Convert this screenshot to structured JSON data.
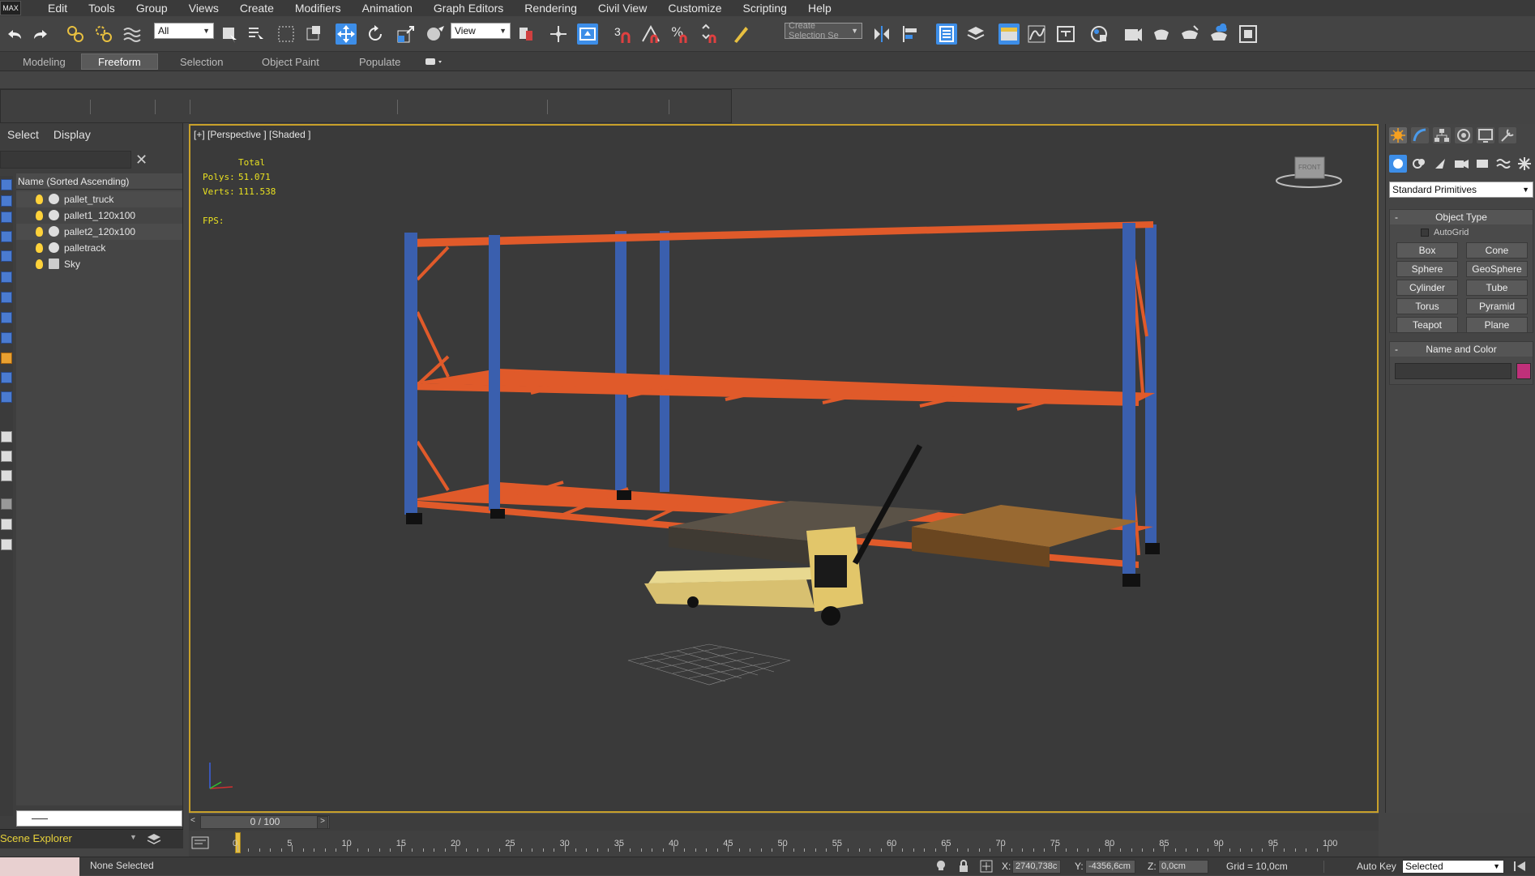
{
  "menu": {
    "logo": "MAX",
    "items": [
      "Edit",
      "Tools",
      "Group",
      "Views",
      "Create",
      "Modifiers",
      "Animation",
      "Graph Editors",
      "Rendering",
      "Civil View",
      "Customize",
      "Scripting",
      "Help"
    ]
  },
  "toolbar": {
    "filter_value": "All",
    "ref_coord_value": "View",
    "selection_set_placeholder": "Create Selection Se",
    "snap_label": "3"
  },
  "ribbon": {
    "tabs": [
      "Modeling",
      "Freeform",
      "Selection",
      "Object Paint",
      "Populate"
    ],
    "active_tab": "Freeform"
  },
  "explorer": {
    "tabs": [
      "Select",
      "Display"
    ],
    "column_header": "Name (Sorted Ascending)",
    "objects": [
      "pallet_truck",
      "pallet1_120x100",
      "pallet2_120x100",
      "palletrack",
      "Sky"
    ],
    "footer_label": "Scene Explorer"
  },
  "viewport": {
    "label": "[+] [Perspective ] [Shaded ]",
    "stats": {
      "total_label": "Total",
      "polys_label": "Polys:",
      "polys_value": "51.071",
      "verts_label": "Verts:",
      "verts_value": "111.538",
      "fps_label": "FPS:"
    },
    "viewcube_label": "FRONT"
  },
  "command_panel": {
    "category": "Standard Primitives",
    "object_type_title": "Object Type",
    "autogrid_label": "AutoGrid",
    "primitives": [
      "Box",
      "Cone",
      "Sphere",
      "GeoSphere",
      "Cylinder",
      "Tube",
      "Torus",
      "Pyramid",
      "Teapot",
      "Plane"
    ],
    "name_color_title": "Name and Color",
    "object_color": "#c0307a"
  },
  "timeline": {
    "frame_display": "0 / 100",
    "ticks": [
      "0",
      "5",
      "10",
      "15",
      "20",
      "25",
      "30",
      "35",
      "40",
      "45",
      "50",
      "55",
      "60",
      "65",
      "70",
      "75",
      "80",
      "85",
      "90",
      "95",
      "100"
    ]
  },
  "status": {
    "selection_text": "None Selected",
    "x_label": "X:",
    "x_value": "2740,738c",
    "y_label": "Y:",
    "y_value": "-4356,6cm",
    "z_label": "Z:",
    "z_value": "0,0cm",
    "grid_text": "Grid = 10,0cm",
    "autokey_label": "Auto Key",
    "autokey_value": "Selected"
  },
  "colors": {
    "accent_blue": "#3d8ee8",
    "viewport_border": "#c8a02a",
    "rack_upright": "#3a5fae",
    "rack_beam": "#e05a2a"
  }
}
